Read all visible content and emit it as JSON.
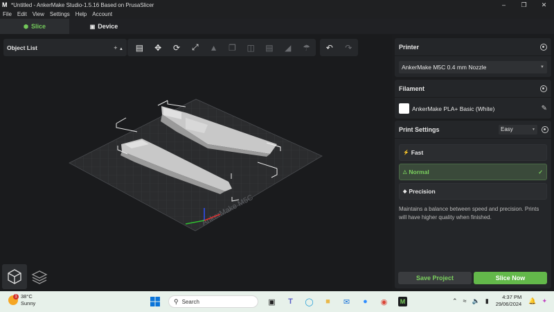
{
  "window": {
    "title": "*Untitled - AnkerMake Studio-1.5.16 Based on PrusaSlicer",
    "logo": "M",
    "controls": [
      "minimize-icon",
      "restore-icon",
      "close-icon"
    ]
  },
  "menu": [
    "File",
    "Edit",
    "View",
    "Settings",
    "Help",
    "Account"
  ],
  "tabs": [
    {
      "label": "Slice",
      "icon": "cube-icon",
      "active": true
    },
    {
      "label": "Device",
      "icon": "device-icon",
      "active": false
    }
  ],
  "object_list": {
    "title": "Object List",
    "add": "+"
  },
  "viewport": {
    "bed_label": "AnkerMake M5C"
  },
  "printer": {
    "header": "Printer",
    "selected": "AnkerMake M5C 0.4 mm Nozzle"
  },
  "filament": {
    "header": "Filament",
    "name": "AnkerMake PLA+ Basic (White)",
    "swatch_color": "#ffffff"
  },
  "print_settings": {
    "header": "Print Settings",
    "mode": "Easy",
    "options": [
      {
        "label": "Fast",
        "icon": "lightning-icon",
        "selected": false
      },
      {
        "label": "Normal",
        "icon": "balance-icon",
        "selected": true
      },
      {
        "label": "Precision",
        "icon": "diamond-icon",
        "selected": false
      }
    ],
    "description": "Maintains a balance between speed and precision. Prints will have higher quality when finished."
  },
  "buttons": {
    "save": "Save Project",
    "slice": "Slice Now"
  },
  "accent_color": "#63b84a",
  "taskbar": {
    "weather_temp": "38°C",
    "weather_cond": "Sunny",
    "weather_badge": "1",
    "search_placeholder": "Search",
    "time": "4:37 PM",
    "date": "29/06/2024"
  }
}
